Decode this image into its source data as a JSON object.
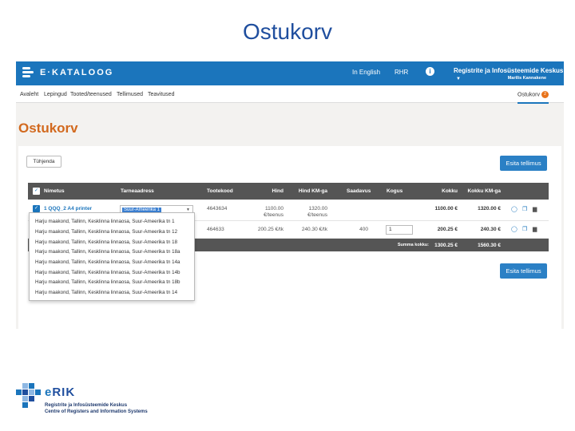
{
  "slide_title": "Ostukorv",
  "topbar": {
    "logo": "E·KATALOOG",
    "lang_link": "In English",
    "rhr_link": "RHR",
    "info_icon": "info-icon",
    "org_name": "Registrite ja Infosüsteemide Keskus",
    "user_name": "Marilis Kannakene"
  },
  "nav": {
    "items": [
      "Avaleht",
      "Lepingud",
      "Tooted/teenused",
      "Tellimused",
      "Teavitused"
    ],
    "cart_tab": "Ostukorv",
    "cart_count": "2"
  },
  "page_heading": "Ostukorv",
  "buttons": {
    "empty": "Tühjenda",
    "submit": "Esita tellimus"
  },
  "table": {
    "headers": [
      "Nimetus",
      "Tarneaadress",
      "Tootekood",
      "Hind",
      "Hind KM-ga",
      "Saadavus",
      "Kogus",
      "Kokku",
      "Kokku KM-ga"
    ],
    "rows": [
      {
        "name": "1 QQQ_2 A4 printer",
        "address": "Suur-Ameerika 1",
        "code": "4643634",
        "price": "1100.00",
        "price_unit": "€/teenus",
        "price_vat": "1320.00",
        "price_vat_unit": "€/teenus",
        "availability": "",
        "qty": "",
        "total": "1100.00 €",
        "total_vat": "1320.00 €"
      },
      {
        "name": "",
        "address": "",
        "code": "464633",
        "price": "200.25 €/tk",
        "price_unit": "",
        "price_vat": "240.30 €/tk",
        "price_vat_unit": "",
        "availability": "400",
        "qty": "1",
        "total": "200.25 €",
        "total_vat": "240.30 €"
      }
    ],
    "sum_label": "Summa kokku:",
    "sum_total": "1300.25 €",
    "sum_total_vat": "1560.30 €"
  },
  "dropdown_options": [
    "Harju maakond, Tallinn, Kesklinna linnaosa, Suur-Ameerika tn 1",
    "Harju maakond, Tallinn, Kesklinna linnaosa, Suur-Ameerika tn 12",
    "Harju maakond, Tallinn, Kesklinna linnaosa, Suur-Ameerika tn 18",
    "Harju maakond, Tallinn, Kesklinna linnaosa, Suur-Ameerika tn 18a",
    "Harju maakond, Tallinn, Kesklinna linnaosa, Suur-Ameerika tn 14a",
    "Harju maakond, Tallinn, Kesklinna linnaosa, Suur-Ameerika tn 14b",
    "Harju maakond, Tallinn, Kesklinna linnaosa, Suur-Ameerika tn 18b",
    "Harju maakond, Tallinn, Kesklinna linnaosa, Suur-Ameerika tn 14"
  ],
  "footer": {
    "brand_e": "e",
    "brand_rest": "RIK",
    "line1": "Registrite ja Infosüsteemide Keskus",
    "line2": "Centre of Registers and Information Systems"
  },
  "colors": {
    "primary": "#1b75bc",
    "heading_orange": "#d2691e",
    "table_header": "#555555"
  }
}
